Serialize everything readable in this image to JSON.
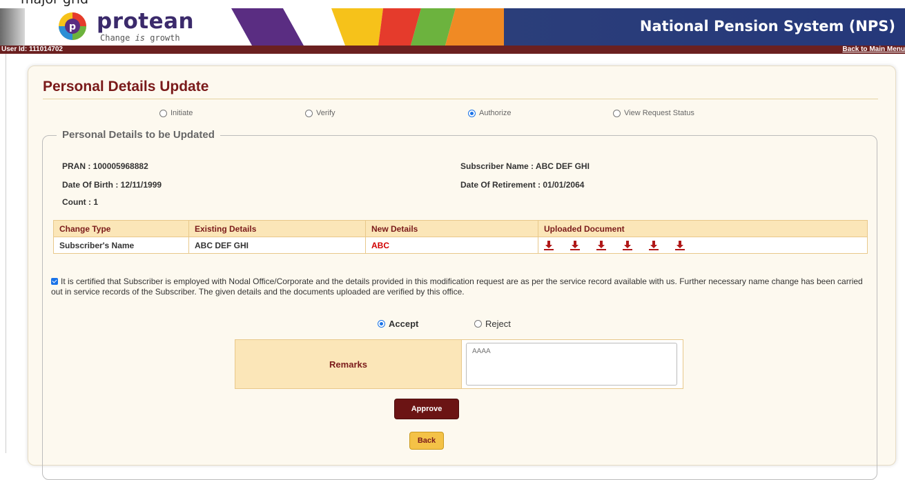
{
  "crop_text": "major grid",
  "header": {
    "brand": "protean",
    "tagline_prefix": "Change ",
    "tagline_italic": "is",
    "tagline_suffix": " growth",
    "title": "National Pension System (NPS)",
    "colors": {
      "brand_purple": "#3b2a6b",
      "header_blue": "#2b3e7a",
      "userbar": "#6b2020"
    }
  },
  "userbar": {
    "user_id": "User Id: 111014702",
    "back_link": "Back to Main Menu"
  },
  "page": {
    "title": "Personal Details Update",
    "steps": [
      {
        "label": "Initiate",
        "selected": false
      },
      {
        "label": "Verify",
        "selected": false
      },
      {
        "label": "Authorize",
        "selected": true
      },
      {
        "label": "View Request Status",
        "selected": false
      }
    ],
    "section_legend": "Personal Details to be Updated",
    "info": {
      "pran": "PRAN : 100005968882",
      "subscriber_name": "Subscriber Name : ABC DEF GHI",
      "dob": "Date Of Birth : 12/11/1999",
      "dor": "Date Of Retirement : 01/01/2064",
      "count": "Count : 1"
    },
    "table": {
      "headers": [
        "Change Type",
        "Existing Details",
        "New Details",
        "Uploaded Document"
      ],
      "rows": [
        {
          "change_type": "Subscriber's Name",
          "existing": "ABC DEF GHI",
          "new": "ABC",
          "documents": 6
        }
      ]
    },
    "certification": "It is certified that Subscriber is employed with Nodal Office/Corporate and the details provided in this modification request are as per the service record available with us. Further necessary name change has been carried out in service records of the Subscriber. The given details and the documents uploaded are verified by this office.",
    "decision": {
      "accept": "Accept",
      "reject": "Reject",
      "selected": "Accept"
    },
    "remarks": {
      "label": "Remarks",
      "value": "AAAA"
    },
    "buttons": {
      "approve": "Approve",
      "back": "Back"
    }
  }
}
